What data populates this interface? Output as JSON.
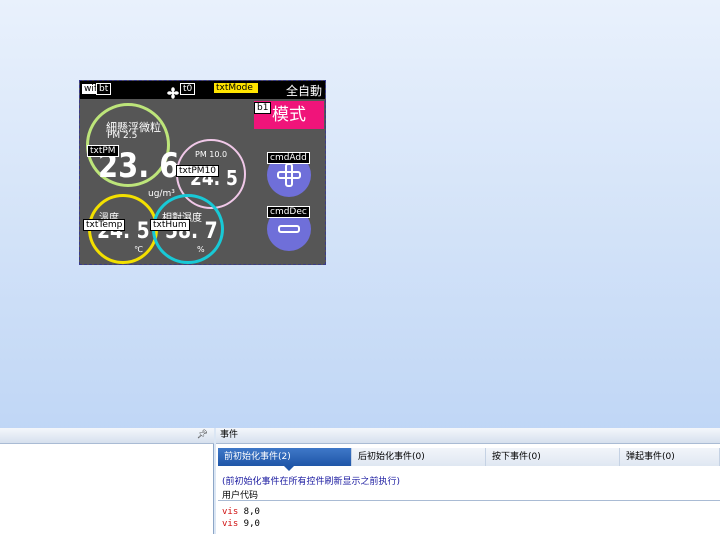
{
  "canvas": {
    "topbar": {
      "wifi_label": "wifi",
      "b_label": "bt",
      "fan_label": "t0",
      "mode_label": "txtMode",
      "status_text": "全自動"
    },
    "mode_button": {
      "id_label": "b1",
      "text": "模式"
    },
    "pm25": {
      "title": "細懸浮微粒",
      "subtitle": "PM 2.5",
      "id_label": "txtPM",
      "value": "23. 6",
      "unit": "ug/m³"
    },
    "pm10": {
      "title": "PM 10.0",
      "id_label": "txtPM10",
      "value": "24. 5"
    },
    "temp": {
      "title": "溫度",
      "id_label": "txtTemp",
      "value": "24. 5",
      "unit": "℃"
    },
    "hum": {
      "title": "相對濕度",
      "id_label": "txtHum",
      "value": "58. 7",
      "unit": "%"
    },
    "add_button": {
      "id_label": "cmdAdd"
    },
    "dec_button": {
      "id_label": "cmdDec"
    },
    "colors": {
      "pm25_ring": "#bde57a",
      "pm10_ring": "#f0c8e8",
      "temp_ring": "#f3e000",
      "hum_ring": "#18c9d6",
      "mode": "#f0147a",
      "button": "#6f6fd9"
    }
  },
  "events_panel": {
    "title": "事件",
    "tabs": [
      {
        "label": "前初始化事件(2)",
        "active": true
      },
      {
        "label": "后初始化事件(0)",
        "active": false
      },
      {
        "label": "按下事件(0)",
        "active": false
      },
      {
        "label": "弹起事件(0)",
        "active": false
      }
    ],
    "description": "(前初始化事件在所有控件刷新显示之前执行)",
    "code_label": "用户代码",
    "code": [
      {
        "keyword": "vis",
        "args": " 8,0"
      },
      {
        "keyword": "vis",
        "args": " 9,0"
      }
    ]
  },
  "left_panel": {
    "pin_icon": "pin-icon"
  }
}
